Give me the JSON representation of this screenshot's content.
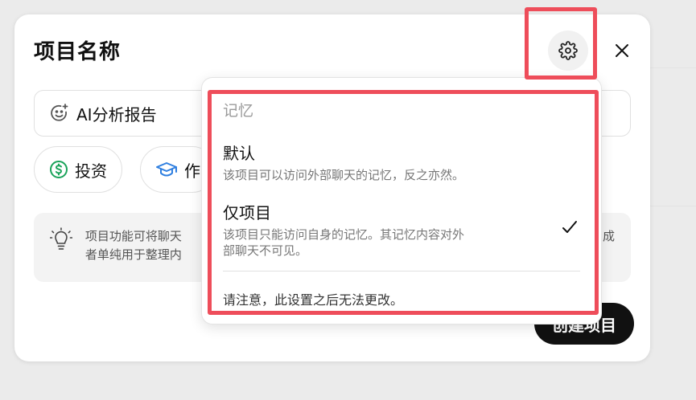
{
  "dialog": {
    "title": "项目名称",
    "name_input_value": "AI分析报告",
    "chips": [
      {
        "label": "投资",
        "icon": "dollar-circle-icon"
      },
      {
        "label": "作",
        "icon": "graduation-cap-icon"
      }
    ],
    "tip_text": "项目功能可将聊天… 成者单纯用于整理内…",
    "tip_line1": "项目功能可将聊天",
    "tip_line1_end": "成",
    "tip_line2": "者单纯用于整理内",
    "create_button": "创建项目"
  },
  "popover": {
    "section_title": "记忆",
    "options": [
      {
        "title": "默认",
        "description": "该项目可以访问外部聊天的记忆，反之亦然。",
        "selected": false
      },
      {
        "title": "仅项目",
        "description_line1": "该项目只能访问自身的记忆。其记忆内容对外",
        "description_line2": "部聊天不可见。",
        "selected": true
      }
    ],
    "notice": "请注意，此设置之后无法更改。"
  },
  "colors": {
    "highlight": "#ee4d5a",
    "dollar_icon": "#1aa35a",
    "cap_icon": "#2f7fe0",
    "primary_button": "#111111"
  }
}
